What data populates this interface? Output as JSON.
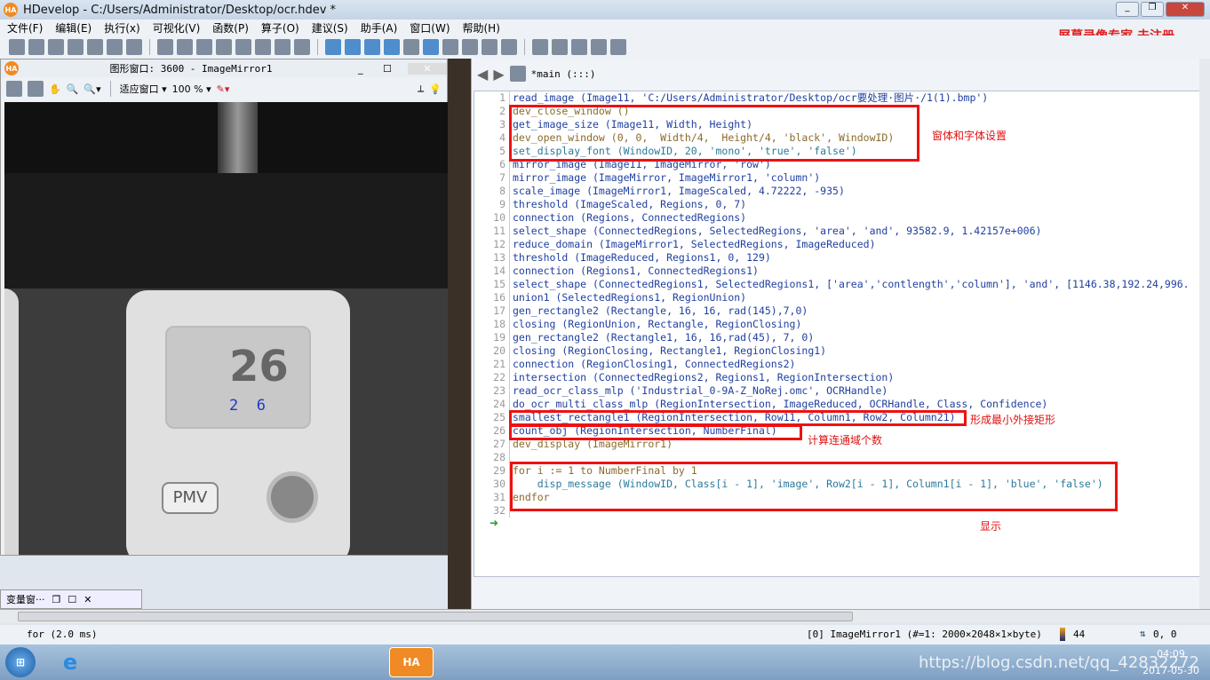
{
  "window": {
    "title": "HDevelop - C:/Users/Administrator/Desktop/ocr.hdev *",
    "logo": "HA"
  },
  "menu": [
    "文件(F)",
    "编辑(E)",
    "执行(x)",
    "可视化(V)",
    "函数(P)",
    "算子(O)",
    "建议(S)",
    "助手(A)",
    "窗口(W)",
    "帮助(H)"
  ],
  "watermark": "屏幕录像专家  未注册",
  "graphics_window": {
    "title": "图形窗口: 3600 - ImageMirror1",
    "fit_label": "适应窗口",
    "zoom": "100 %",
    "ocr_overlay": "2  6",
    "lcd_text": "26",
    "button_label": "PMV"
  },
  "variable_window": {
    "title": "变量窗···"
  },
  "editor": {
    "tab": "*main (:::)",
    "lines": [
      {
        "n": "1",
        "t": "read_image (Image11, 'C:/Users/Administrator/Desktop/ocr要处理·图片·/1(1).bmp')",
        "k": "op"
      },
      {
        "n": "2",
        "t": "dev_close_window ()",
        "k": "dev"
      },
      {
        "n": "3",
        "t": "get_image_size (Image11, Width, Height)",
        "k": "op"
      },
      {
        "n": "4",
        "t": "dev_open_window (0, 0,  Width/4,  Height/4, 'black', WindowID)",
        "k": "dev"
      },
      {
        "n": "5",
        "t": "set_display_font (WindowID, 20, 'mono', 'true', 'false')",
        "k": "msg"
      },
      {
        "n": "6",
        "t": "mirror_image (Image11, ImageMirror, 'row')",
        "k": "op"
      },
      {
        "n": "7",
        "t": "mirror_image (ImageMirror, ImageMirror1, 'column')",
        "k": "op"
      },
      {
        "n": "8",
        "t": "scale_image (ImageMirror1, ImageScaled, 4.72222, -935)",
        "k": "op"
      },
      {
        "n": "9",
        "t": "threshold (ImageScaled, Regions, 0, 7)",
        "k": "op"
      },
      {
        "n": "10",
        "t": "connection (Regions, ConnectedRegions)",
        "k": "op"
      },
      {
        "n": "11",
        "t": "select_shape (ConnectedRegions, SelectedRegions, 'area', 'and', 93582.9, 1.42157e+006)",
        "k": "op"
      },
      {
        "n": "12",
        "t": "reduce_domain (ImageMirror1, SelectedRegions, ImageReduced)",
        "k": "op"
      },
      {
        "n": "13",
        "t": "threshold (ImageReduced, Regions1, 0, 129)",
        "k": "op"
      },
      {
        "n": "14",
        "t": "connection (Regions1, ConnectedRegions1)",
        "k": "op"
      },
      {
        "n": "15",
        "t": "select_shape (ConnectedRegions1, SelectedRegions1, ['area','contlength','column'], 'and', [1146.38,192.24,996.",
        "k": "op"
      },
      {
        "n": "16",
        "t": "union1 (SelectedRegions1, RegionUnion)",
        "k": "op"
      },
      {
        "n": "17",
        "t": "gen_rectangle2 (Rectangle, 16, 16, rad(145),7,0)",
        "k": "op"
      },
      {
        "n": "18",
        "t": "closing (RegionUnion, Rectangle, RegionClosing)",
        "k": "op"
      },
      {
        "n": "19",
        "t": "gen_rectangle2 (Rectangle1, 16, 16,rad(45), 7, 0)",
        "k": "op"
      },
      {
        "n": "20",
        "t": "closing (RegionClosing, Rectangle1, RegionClosing1)",
        "k": "op"
      },
      {
        "n": "21",
        "t": "connection (RegionClosing1, ConnectedRegions2)",
        "k": "op"
      },
      {
        "n": "22",
        "t": "intersection (ConnectedRegions2, Regions1, RegionIntersection)",
        "k": "op"
      },
      {
        "n": "23",
        "t": "read_ocr_class_mlp ('Industrial_0-9A-Z_NoRej.omc', OCRHandle)",
        "k": "op"
      },
      {
        "n": "24",
        "t": "do_ocr_multi_class_mlp (RegionIntersection, ImageReduced, OCRHandle, Class, Confidence)",
        "k": "op"
      },
      {
        "n": "25",
        "t": "smallest_rectangle1 (RegionIntersection, Row11, Column1, Row2, Column21)",
        "k": "op"
      },
      {
        "n": "26",
        "t": "count_obj (RegionIntersection, NumberFinal)",
        "k": "op"
      },
      {
        "n": "27",
        "t": "dev_display (ImageMirror1)",
        "k": "dev"
      },
      {
        "n": "28",
        "t": "",
        "k": "op"
      },
      {
        "n": "29",
        "t": "for i := 1 to NumberFinal by 1",
        "k": "ctl"
      },
      {
        "n": "30",
        "t": "    disp_message (WindowID, Class[i - 1], 'image', Row2[i - 1], Column1[i - 1], 'blue', 'false')",
        "k": "msg"
      },
      {
        "n": "31",
        "t": "endfor",
        "k": "ctl"
      },
      {
        "n": "32",
        "t": "",
        "k": "op"
      }
    ],
    "annotations": {
      "window_font": "窗体和字体设置",
      "smallest_rect": "形成最小外接矩形",
      "count": "计算连通域个数",
      "display": "显示"
    }
  },
  "status": {
    "left": "for (2.0 ms)",
    "image_info": "[0] ImageMirror1 (#=1: 2000×2048×1×byte)",
    "gray": "44",
    "coords": "0, 0"
  },
  "taskbar": {
    "time": "04:09",
    "date": "2017-05-30",
    "overlay": "https://blog.csdn.net/qq_42832272",
    "ha": "HA"
  },
  "colors": {
    "highlight": "#ee1111",
    "taskbar": "#8fb0d0"
  }
}
